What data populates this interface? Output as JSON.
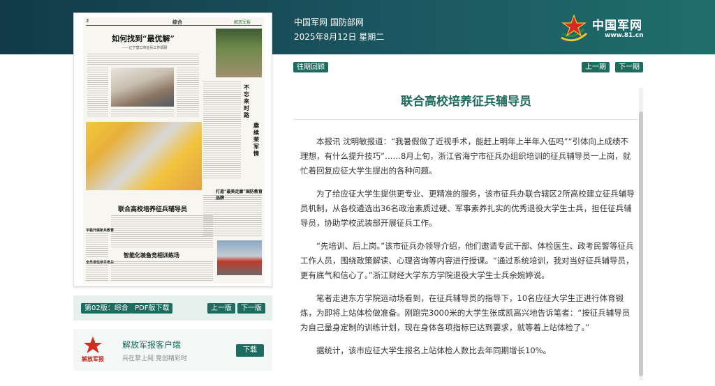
{
  "header": {
    "site": "中国军网 国防部网",
    "date": "2025年8月12日 星期二",
    "logo_name": "中国军网",
    "logo_url": "www.81.cn"
  },
  "toolbar": {
    "history_label": "往期回顾",
    "prev_issue_label": "上一期",
    "next_issue_label": "下一期"
  },
  "newspaper": {
    "page_number": "2",
    "section": "综合",
    "brand": "解放军报",
    "headline_main": "如何找到“最优解”",
    "headline_sub": "——辽宁营口市征兵工作调研",
    "vertical_title_1": "不忘来时路",
    "vertical_title_2": "赓续荣军情",
    "headline_mid": "联合高校培养征兵辅导员",
    "headline_right": "打造“最美走廊”国防教育品牌",
    "headline_bottom": "智能化装备竞相训练场",
    "side_1": "平稳开展新兵教育",
    "side_2": "全员退伍参见老兵"
  },
  "page_bar": {
    "page_label": "第02版：综合",
    "pdf_label": "PDF版下载",
    "prev_page_label": "上一版",
    "next_page_label": "下一版"
  },
  "client": {
    "title": "解放军报客户端",
    "subtitle": "兵在掌上阅 竞创精彩时",
    "download_label": "下载",
    "logo_text": "解放军报"
  },
  "article": {
    "title": "联合高校培养征兵辅导员",
    "paragraphs": [
      "本报讯 沈明敏报道：“我暑假做了近视手术，能赶上明年上半年入伍吗”“引体向上成绩不理想，有什么提升技巧”……8月上旬，浙江省海宁市征兵办组织培训的征兵辅导员一上岗，就忙着回复应征大学生提出的各种问题。",
      "为了给应征大学生提供更专业、更精准的服务，该市征兵办联合辖区2所高校建立征兵辅导员机制，从各校遴选出36名政治素质过硬、军事素养扎实的优秀退役大学生士兵，担任征兵辅导员，协助学校武装部开展征兵工作。",
      "“先培训、后上岗。”该市征兵办领导介绍，他们邀请专武干部、体检医生、政考民警等征兵工作人员，围绕政策解读、心理咨询等内容进行授课。“通过系统培训，我对当好征兵辅导员，更有底气和信心了。”浙江财经大学东方学院退役大学生士兵余婉婷说。",
      "笔者走进东方学院运动场看到，在征兵辅导员的指导下，10名应征大学生正进行体育锻炼，为即将上站体检做准备。刚跑完3000米的大学生张成凯高兴地告诉笔者：“按征兵辅导员为自己量身定制的训练计划，现在身体各项指标已达到要求，就等着上站体检了。”",
      "据统计，该市应征大学生报名上站体检人数比去年同期增长10%。"
    ]
  },
  "colors": {
    "accent": "#1e6b5f",
    "header_dark": "#123a48",
    "header_light": "#1f6e6c",
    "logo_red": "#d32b22",
    "logo_gold": "#f2c230"
  },
  "icons": {
    "site_logo": "red-star-emblem-icon",
    "client_logo": "red-star-icon"
  }
}
